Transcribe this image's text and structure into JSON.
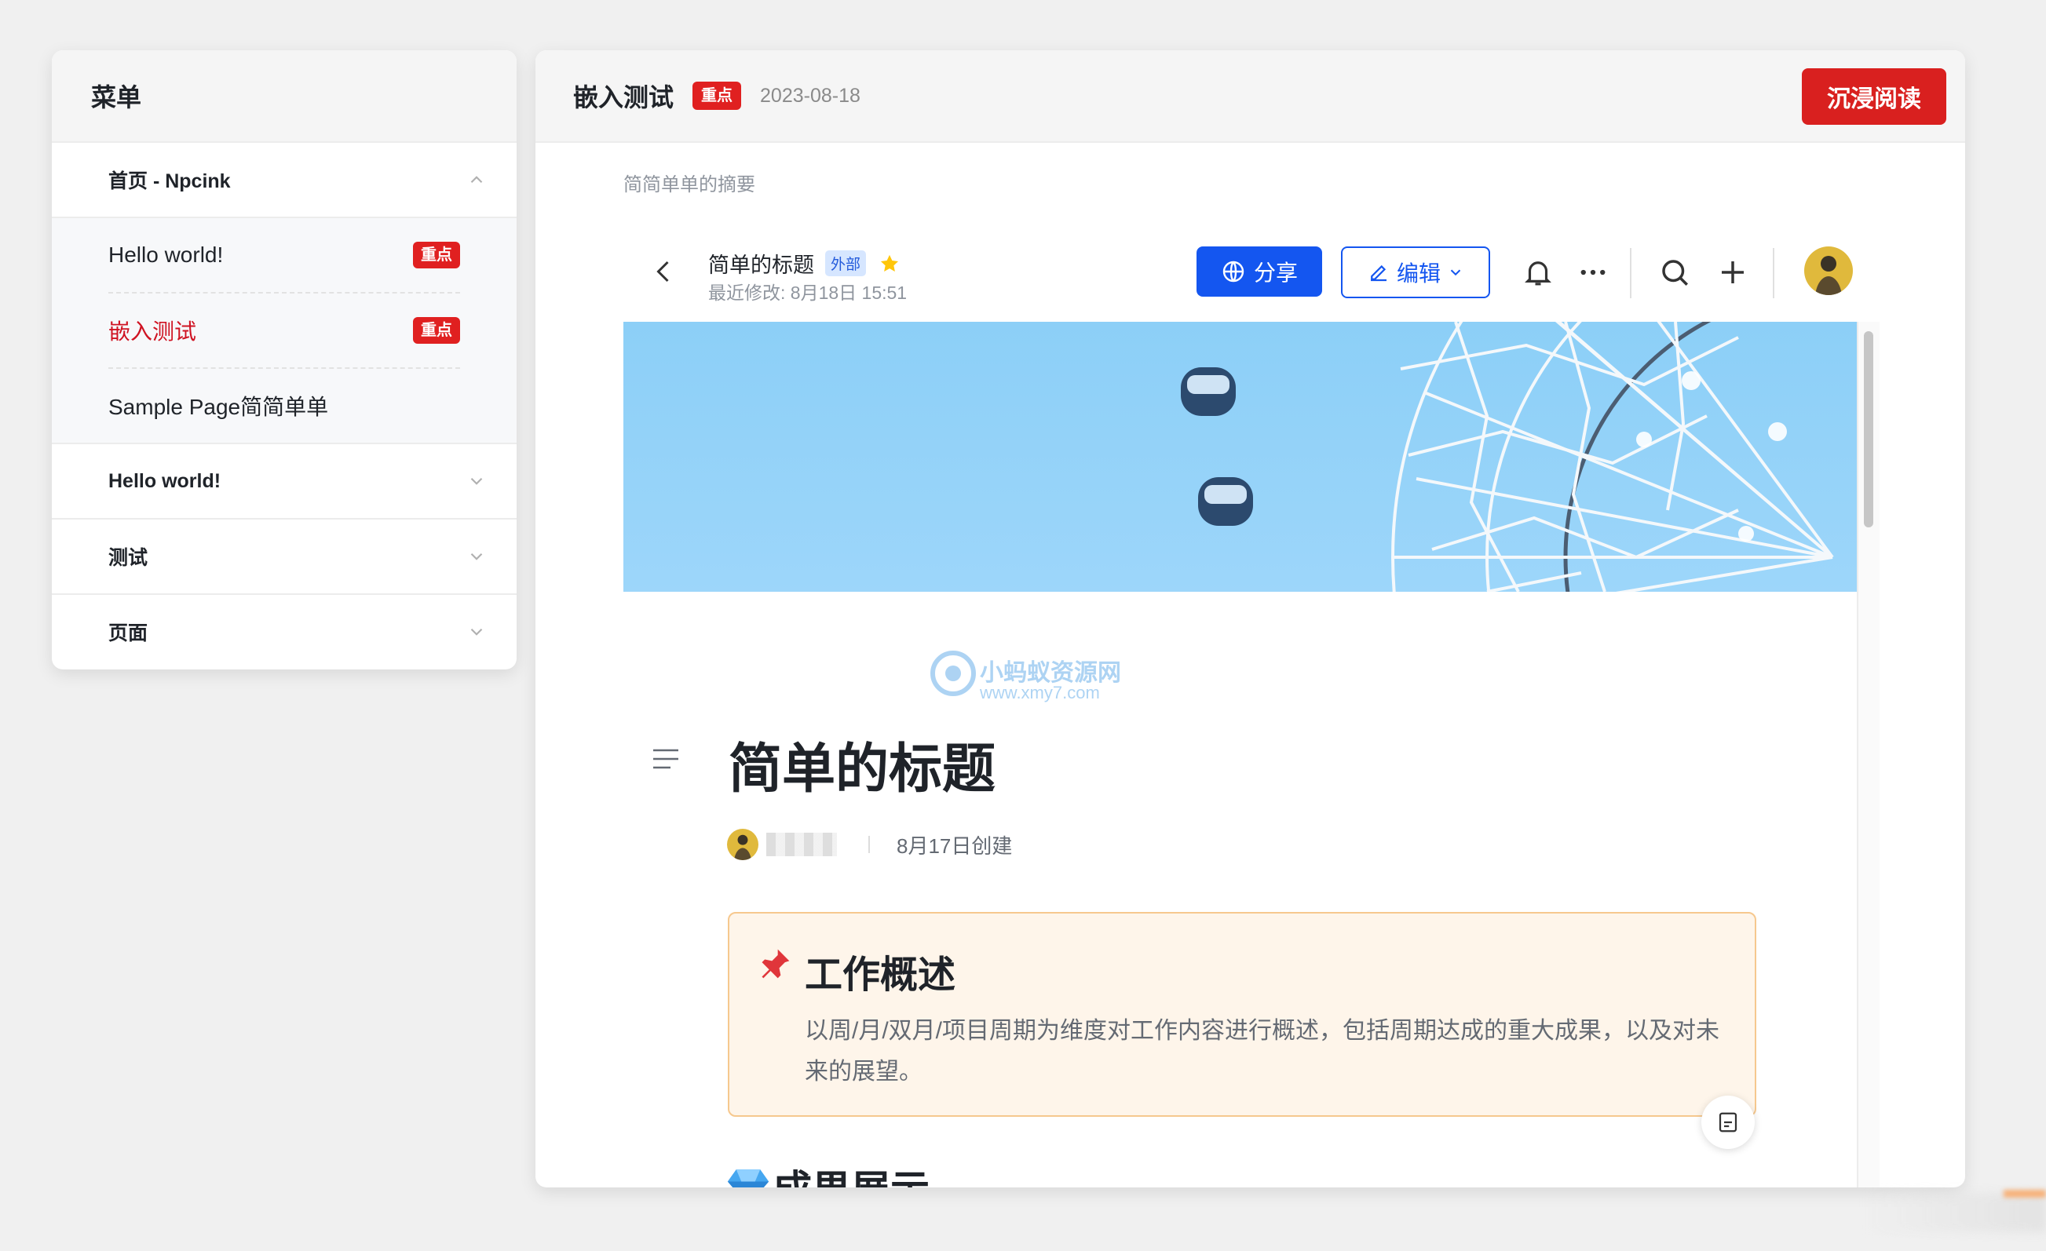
{
  "sidebar": {
    "title": "菜单",
    "sections": [
      {
        "label": "首页 - Npcink",
        "expanded": true,
        "items": [
          {
            "label": "Hello world!",
            "badge": "重点",
            "active": false
          },
          {
            "label": "嵌入测试",
            "badge": "重点",
            "active": true
          },
          {
            "label": "Sample Page简简单单",
            "badge": "",
            "active": false
          }
        ]
      },
      {
        "label": "Hello world!",
        "expanded": false
      },
      {
        "label": "测试",
        "expanded": false
      },
      {
        "label": "页面",
        "expanded": false
      }
    ]
  },
  "post": {
    "title": "嵌入测试",
    "badge": "重点",
    "date": "2023-08-18",
    "read_button": "沉浸阅读",
    "summary": "简简单单的摘要"
  },
  "doc": {
    "title": "简单的标题",
    "external_tag": "外部",
    "last_modified": "最近修改: 8月18日 15:51",
    "share_label": "分享",
    "edit_label": "编辑",
    "heading": "简单的标题",
    "created": "8月17日创建",
    "callout_title": "工作概述",
    "callout_text": "以周/月/双月/项目周期为维度对工作内容进行概述，包括周期达成的重大成果，以及对未来的展望。",
    "section_heading": "成果展示"
  },
  "watermark": {
    "line1": "小蚂蚁资源网",
    "line2": "www.xmy7.com"
  },
  "colors": {
    "accent_red": "#d9201f",
    "accent_blue": "#1456f0",
    "callout_bg": "#fef5ea"
  }
}
